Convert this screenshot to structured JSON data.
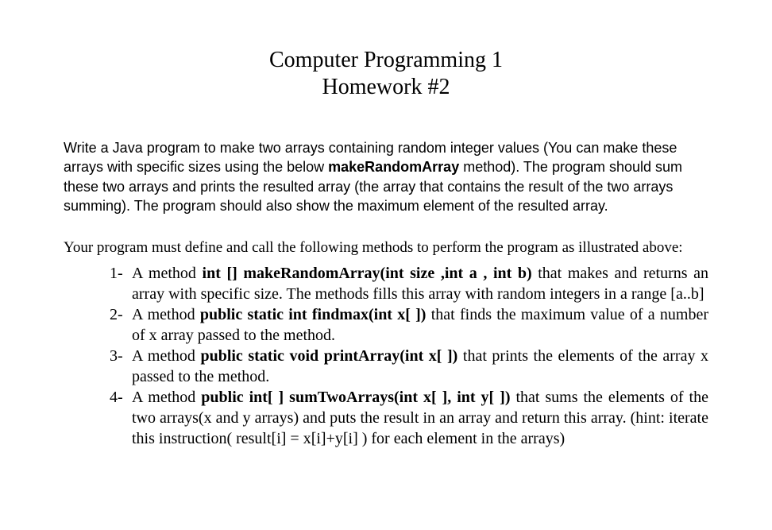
{
  "title": "Computer Programming 1",
  "subtitle": "Homework #2",
  "intro_part1": "Write a Java program to make two arrays containing random integer values (You can make these arrays with specific sizes using the below ",
  "intro_method": "makeRandomArray",
  "intro_part2": " method). The program should sum these two arrays and prints the resulted array (the array that contains the result of the two arrays summing).  The program should also show the maximum element of the resulted array.",
  "methods_intro": "Your program must define and call the following methods to perform the program as illustrated above:",
  "items": [
    {
      "marker": "1-",
      "pre": "A method ",
      "sig": "int [] makeRandomArray(int size ,int a , int b)",
      "post": " that makes and returns an array with specific size. The methods  fills this array with random integers in a range [a..b]"
    },
    {
      "marker": "2-",
      "pre": "A method ",
      "sig": "public static int findmax(int x[ ])",
      "post": " that finds the maximum value of a number of x array passed to the method."
    },
    {
      "marker": "3-",
      "pre": "A method ",
      "sig": "public static void printArray(int x[ ])",
      "post": " that prints the elements of the array x passed to the method."
    },
    {
      "marker": "4-",
      "pre": "A method ",
      "sig": "public int[ ] sumTwoArrays(int x[ ], int y[ ])",
      "post": " that sums the elements of the two arrays(x and y arrays) and puts the result in an array and return this array. (hint: iterate this instruction( result[i] = x[i]+y[i] ) for each element in the arrays)"
    }
  ]
}
